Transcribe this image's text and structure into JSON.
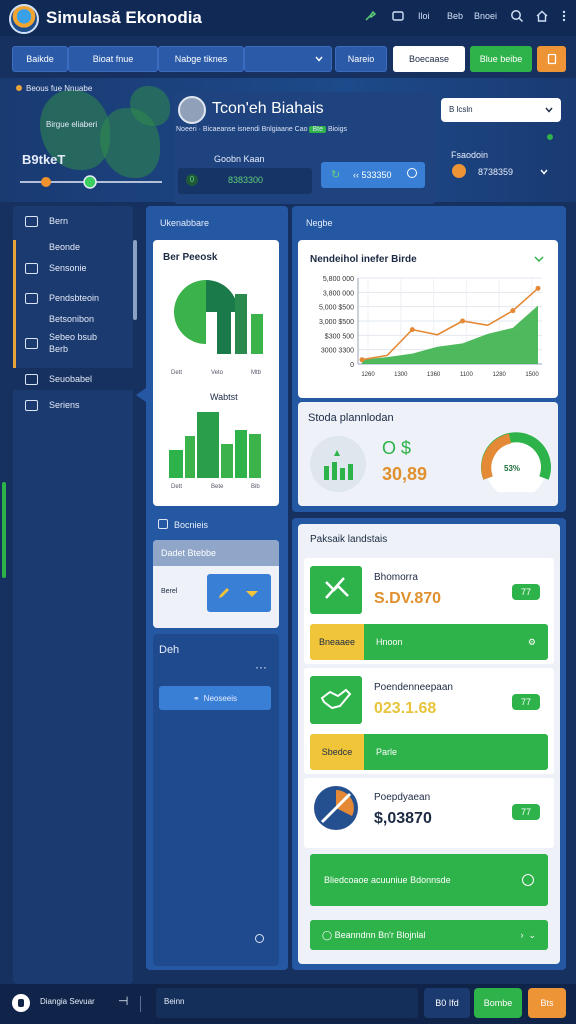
{
  "app": {
    "title": "Simulasă Ekonodia"
  },
  "titlebar": {
    "items": [
      "Iloi",
      "Beb",
      "Bnoei"
    ]
  },
  "toolbar": {
    "tabs": [
      "Baikde",
      "Bioat fnue",
      "Nabge tiknes"
    ],
    "select_label": "Nareio",
    "button_white": "Boecaase",
    "button_green": "Blue beibe"
  },
  "header": {
    "map_caption": "Beous fue Nnuabe",
    "map_sub": "Birgue eliaberi",
    "map_value": "B9tkeT",
    "profile_title": "Tcon'eh Biahais",
    "profile_sub_left": "Noeeri · Bicaeanse isnendi Bnlgiaane Cao",
    "profile_sub_badge": "Bte",
    "profile_sub_right": "Bioigs",
    "stat_label": "Goobn Kaan",
    "stat_value": "8383300",
    "action_value": "‹‹ 533350",
    "dropdown_label": "B lcsln",
    "right_label": "Fsaodoin",
    "right_value": "8738359"
  },
  "sidebar": {
    "items": [
      {
        "label": "Bern",
        "icon": "briefcase-icon"
      },
      {
        "label": "Beonde",
        "icon": ""
      },
      {
        "label": "Sensonie",
        "icon": "monitor-icon"
      },
      {
        "label": "Pendsbteoin",
        "icon": "mail-icon"
      },
      {
        "label": "Betsonibon",
        "icon": ""
      },
      {
        "label": "Sebeo bsub Berb",
        "icon": "shield-icon"
      },
      {
        "label": "Seuobabel",
        "icon": "window-icon"
      },
      {
        "label": "Seriens",
        "icon": "chat-icon"
      }
    ]
  },
  "mid": {
    "header": "Ukenabbare",
    "card_title": "Ber Peeosk",
    "card_caption": "Wabtst",
    "card_ticks_a": [
      "Dett",
      "Veto",
      "Mtb"
    ],
    "card_ticks_b": [
      "Dett",
      "Bete",
      "Bib"
    ],
    "section2_title": "Bocnieis",
    "select_title": "Dadet Btebbe",
    "select_label": "Berel",
    "section3_title": "Deh",
    "section3_more": "···",
    "section3_button": "Neoseeis"
  },
  "right": {
    "header": "Negbe",
    "chart_title": "Nendeihol inefer Birde",
    "summary_title": "Stoda plannlodan",
    "summary_currency": "O $",
    "summary_value": "30,89",
    "summary_percent": "53%",
    "list_header": "Paksaik landstais",
    "list": [
      {
        "name": "Bhomorra",
        "value": "S.DV.870",
        "badge": "77",
        "tag": "Bneaaee",
        "bar_label": "Hnoon",
        "value_color": "#e0902e",
        "tag_color": "yellow",
        "icon": "chart-down-icon"
      },
      {
        "name": "Poendenneepaan",
        "value": "023.1.68",
        "badge": "77",
        "tag": "Sbedce",
        "bar_label": "Parle",
        "value_color": "#e7c43a",
        "tag_color": "yellow",
        "icon": "handshake-icon"
      },
      {
        "name": "Poepdyaean",
        "value": "$,03870",
        "badge": "77",
        "tag": "",
        "bar_label": "",
        "value_color": "#1c2a44",
        "tag_color": "",
        "icon": "pie-icon"
      }
    ],
    "action_bar": "Bliedcoaoe acuuniue Bdonnsde",
    "footer_button": "Beanndnn Bn'r Blojnlal"
  },
  "footer": {
    "profile": "Diangia Sevuar",
    "input": "Beinn",
    "btn_dark": "B0 Ifd",
    "btn_green": "Bombe",
    "btn_orange": "Bts"
  },
  "chart_data": {
    "type": "area",
    "title": "Nendeihol inefer Birde",
    "y_ticks": [
      "5,800 000",
      "3,800 000",
      "5,000 $500",
      "3,000 $500",
      "$300 500",
      "3000 3300",
      "0"
    ],
    "x_ticks": [
      "1260",
      "1300",
      "1360",
      "1100",
      "1280",
      "1500"
    ],
    "x": [
      0,
      1,
      2,
      3,
      4,
      5,
      6,
      7
    ],
    "series": [
      {
        "values": [
          0.05,
          0.08,
          0.12,
          0.2,
          0.24,
          0.35,
          0.42,
          0.68
        ]
      },
      {
        "values": [
          0.05,
          0.1,
          0.4,
          0.34,
          0.5,
          0.45,
          0.62,
          0.88
        ]
      }
    ],
    "colors": [
      "#3cb24b",
      "#e48a37"
    ],
    "grid": true
  }
}
